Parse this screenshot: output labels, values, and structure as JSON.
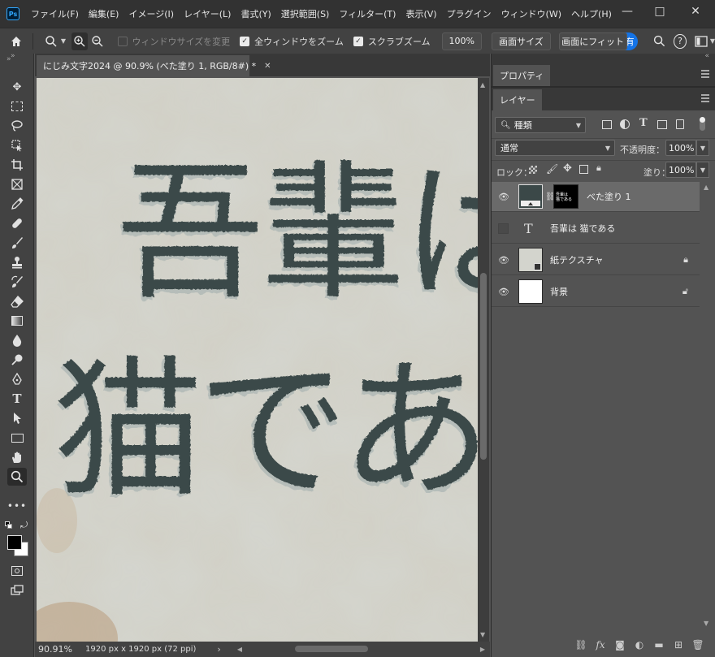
{
  "app": {
    "logo": "Ps",
    "menu": [
      "ファイル(F)",
      "編集(E)",
      "イメージ(I)",
      "レイヤー(L)",
      "書式(Y)",
      "選択範囲(S)",
      "フィルター(T)",
      "表示(V)",
      "プラグイン",
      "ウィンドウ(W)",
      "ヘルプ(H)"
    ],
    "window_controls": [
      "minimize-icon",
      "maximize-icon",
      "close-icon"
    ]
  },
  "options": {
    "resize_window_label": "ウィンドウサイズを変更",
    "resize_window_checked": false,
    "zoom_all_label": "全ウィンドウをズーム",
    "zoom_all_checked": true,
    "scrub_zoom_label": "スクラブズーム",
    "scrub_zoom_checked": true,
    "zoom_value": "100%",
    "fit_screen_label": "画面サイズ",
    "fill_screen_label": "画面にフィット",
    "share_label": "有"
  },
  "document": {
    "tab_title": "にじみ文字2024 @ 90.9% (べた塗り 1, RGB/8#) *",
    "canvas_line1": "吾輩は",
    "canvas_line2": "猫である",
    "text_color": "#3b4848",
    "paper_color": "#d3d4cd"
  },
  "status": {
    "zoom": "90.91%",
    "doc_size": "1920 px x 1920 px (72 ppi)"
  },
  "panels": {
    "properties_tab": "プロパティ",
    "layers_tab": "レイヤー",
    "filter_kind": "種類",
    "blend_mode": "通常",
    "opacity_label": "不透明度：",
    "opacity_value": "100%",
    "lock_label": "ロック：",
    "fill_label": "塗り：",
    "fill_value": "100%",
    "layers": [
      {
        "name": "べた塗り 1",
        "visible": true,
        "selected": true,
        "type": "fill",
        "locked": false
      },
      {
        "name": "吾輩は 猫である",
        "visible": false,
        "selected": false,
        "type": "text",
        "locked": false
      },
      {
        "name": "紙テクスチャ",
        "visible": true,
        "selected": false,
        "type": "smart",
        "locked": true
      },
      {
        "name": "背景",
        "visible": true,
        "selected": false,
        "type": "background",
        "locked": true
      }
    ]
  }
}
